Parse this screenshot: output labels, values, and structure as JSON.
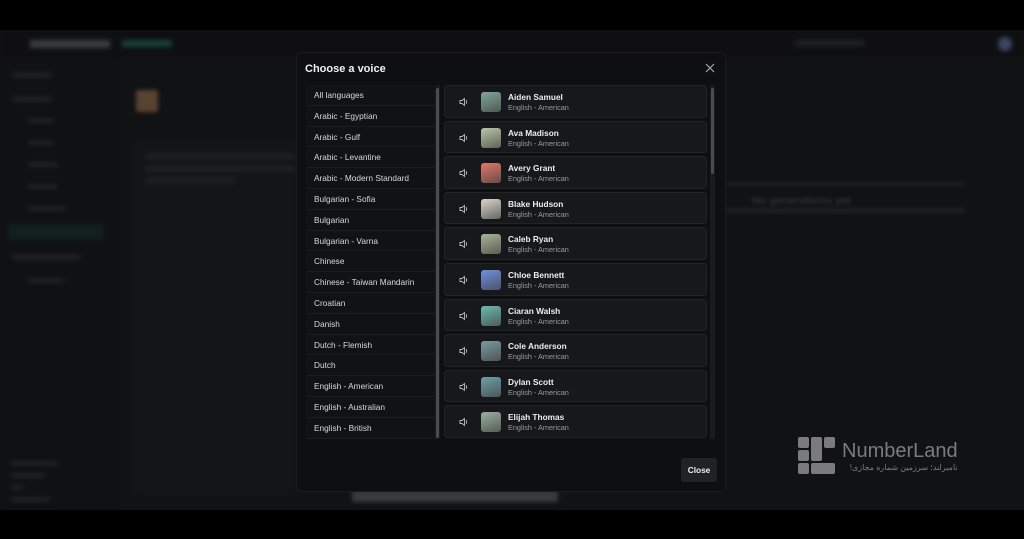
{
  "background": {
    "empty_title": "No generations yet"
  },
  "modal": {
    "title": "Choose a voice",
    "close_label": "Close",
    "languages": [
      "All languages",
      "Arabic - Egyptian",
      "Arabic - Gulf",
      "Arabic - Levantine",
      "Arabic - Modern Standard",
      "Bulgarian - Sofia",
      "Bulgarian",
      "Bulgarian - Varna",
      "Chinese",
      "Chinese - Taiwan Mandarin",
      "Croatian",
      "Danish",
      "Dutch - Flemish",
      "Dutch",
      "English - American",
      "English - Australian",
      "English - British"
    ],
    "voices": [
      {
        "name": "Aiden Samuel",
        "accent": "English - American",
        "avatar_color": "#7fa89a"
      },
      {
        "name": "Ava Madison",
        "accent": "English - American",
        "avatar_color": "#b9c7a8"
      },
      {
        "name": "Avery Grant",
        "accent": "English - American",
        "avatar_color": "#e0786a"
      },
      {
        "name": "Blake Hudson",
        "accent": "English - American",
        "avatar_color": "#d9d3cc"
      },
      {
        "name": "Caleb Ryan",
        "accent": "English - American",
        "avatar_color": "#a8b59a"
      },
      {
        "name": "Chloe Bennett",
        "accent": "English - American",
        "avatar_color": "#6f8fe0"
      },
      {
        "name": "Ciaran Walsh",
        "accent": "English - American",
        "avatar_color": "#6fb8b0"
      },
      {
        "name": "Cole Anderson",
        "accent": "English - American",
        "avatar_color": "#7a9aa0"
      },
      {
        "name": "Dylan Scott",
        "accent": "English - American",
        "avatar_color": "#6fa0a8"
      },
      {
        "name": "Elijah Thomas",
        "accent": "English - American",
        "avatar_color": "#9ab0a0"
      }
    ]
  },
  "watermark": {
    "text": "NumberLand",
    "subtitle": "نامبرلند؛ سرزمین شماره مجازی!"
  }
}
